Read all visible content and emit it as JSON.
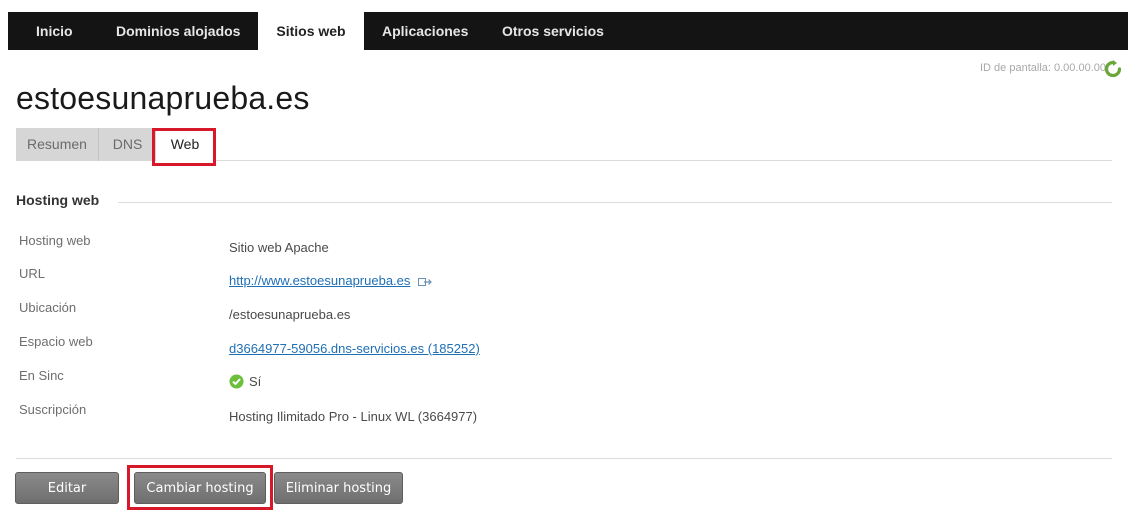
{
  "nav": {
    "tabs": [
      "Inicio",
      "Dominios alojados",
      "Sitios web",
      "Aplicaciones",
      "Otros servicios"
    ],
    "active": "Sitios web"
  },
  "screen_id": "ID de pantalla: 0.00.00.00",
  "page_title": "estoesunaprueba.es",
  "subtabs": [
    "Resumen",
    "DNS",
    "Web"
  ],
  "active_subtab": "Web",
  "section": {
    "title": "Hosting web",
    "rows": [
      {
        "label": "Hosting web",
        "value": "Sitio web Apache"
      },
      {
        "label": "URL",
        "value": "http://www.estoesunaprueba.es"
      },
      {
        "label": "Ubicación",
        "value": "/estoesunaprueba.es"
      },
      {
        "label": "Espacio web",
        "value": "d3664977-59056.dns-servicios.es (185252)"
      },
      {
        "label": "En Sinc",
        "value": "Sí"
      },
      {
        "label": "Suscripción",
        "value": "Hosting Ilimitado Pro - Linux WL (3664977)"
      }
    ]
  },
  "buttons": {
    "edit": "Editar",
    "change": "Cambiar hosting",
    "delete": "Eliminar hosting"
  },
  "colors": {
    "nav_bg": "#141414",
    "highlight": "#d7182a",
    "link": "#1f6fb5",
    "check": "#6bbf3b",
    "button": "#7a7a7a"
  },
  "icons": {
    "refresh": "refresh-icon",
    "external_link": "external-link-icon",
    "check": "check-circle-icon"
  }
}
